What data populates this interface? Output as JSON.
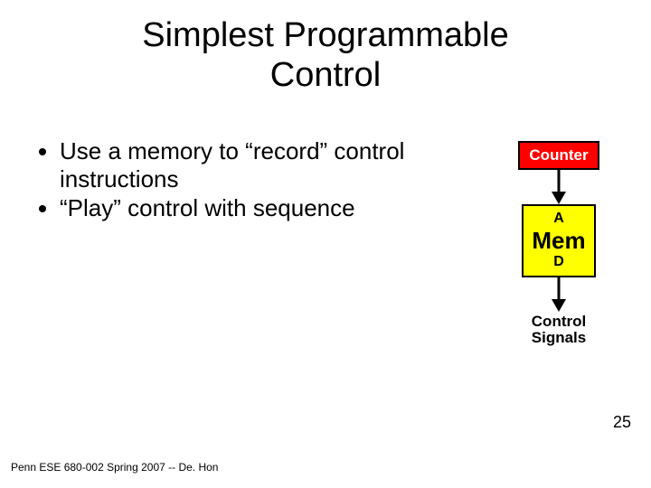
{
  "title_line1": "Simplest Programmable",
  "title_line2": "Control",
  "bullets": {
    "b1": "Use a memory to “record” control instructions",
    "b2": "“Play” control with sequence"
  },
  "diagram": {
    "counter": "Counter",
    "mem_a": "A",
    "mem_label": "Mem",
    "mem_d": "D",
    "ctrl_l1": "Control",
    "ctrl_l2": "Signals"
  },
  "footer": "Penn ESE 680-002 Spring 2007 -- De. Hon",
  "page_number": "25"
}
